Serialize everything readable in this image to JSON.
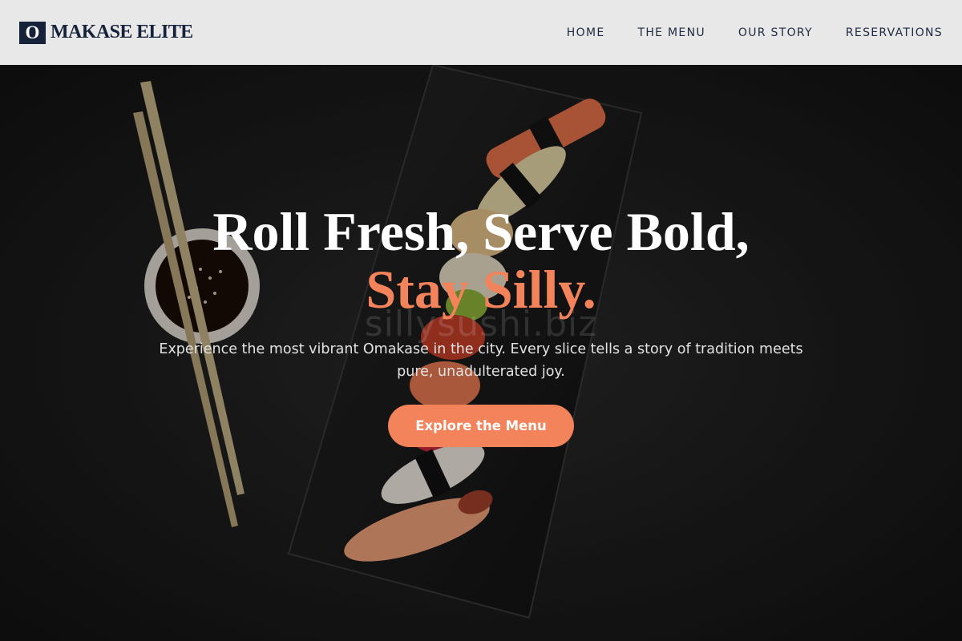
{
  "header": {
    "logo_mark": "O",
    "logo_text": "MAKASE ELITE",
    "nav": [
      {
        "label": "HOME"
      },
      {
        "label": "THE MENU"
      },
      {
        "label": "OUR STORY"
      },
      {
        "label": "RESERVATIONS"
      }
    ]
  },
  "hero": {
    "title_line1": "Roll Fresh, Serve Bold,",
    "title_line2": "Stay Silly.",
    "watermark": "sillysushi.biz",
    "subtitle": "Experience the most vibrant Omakase in the city. Every slice tells a story of tradition meets pure, unadulterated joy.",
    "cta_label": "Explore the Menu"
  },
  "colors": {
    "accent": "#f2835a",
    "brand_navy": "#16213a",
    "header_bg": "#e8e8e9",
    "hero_bg": "#1d1d1d"
  }
}
